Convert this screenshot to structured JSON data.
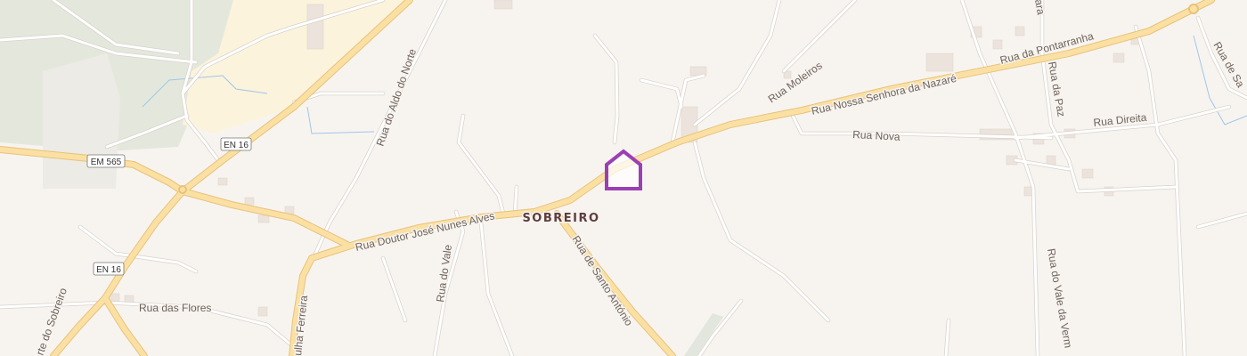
{
  "map": {
    "place_name": "SOBREIRO",
    "marker_icon": "house-icon",
    "marker_color": "#9b3fb4",
    "road_refs": [
      "EN 16",
      "EM 565",
      "EN 16"
    ],
    "streets": [
      "Rua do Aldo do Norte",
      "Rua Doutor José Nunes Alves",
      "Rua de Santo António",
      "Rua do Vale",
      "Rua das Flores",
      "ulha Ferreira",
      "rte do Sobreiro",
      "Rua Moleiros",
      "Rua Nossa Senhora da Nazaré",
      "Rua da Pontarranha",
      "Rua Nova",
      "Rua Direita",
      "Rua da Paz",
      "Rua do Vale da Verm",
      "Rua de Sa",
      "ara"
    ]
  }
}
